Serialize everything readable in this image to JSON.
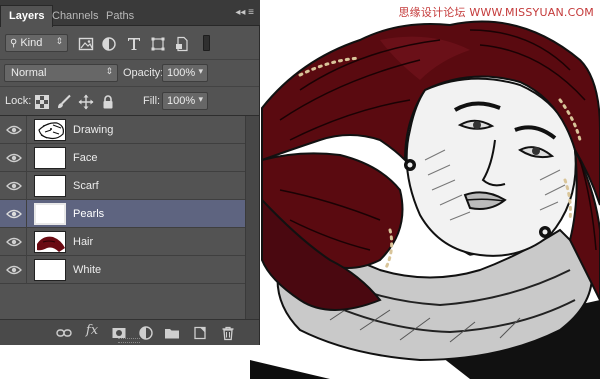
{
  "watermark": "思缘设计论坛 WWW.MISSYUAN.COM",
  "panel": {
    "tabs": [
      "Layers",
      "Channels",
      "Paths"
    ],
    "active_tab": "Layers",
    "menu_glyph": "◂◂ ≡",
    "filter": {
      "kind_label": "Kind",
      "filter_icons": [
        "image-filter-icon",
        "adjustment-filter-icon",
        "type-filter-icon",
        "shape-filter-icon",
        "smart-object-filter-icon"
      ]
    },
    "blend_mode": "Normal",
    "opacity_label": "Opacity:",
    "opacity_value": "100%",
    "lock_label": "Lock:",
    "lock_icons": [
      "lock-transparent-pixels-icon",
      "lock-image-pixels-icon",
      "lock-position-icon",
      "lock-all-icon"
    ],
    "fill_label": "Fill:",
    "fill_value": "100%",
    "layers": [
      {
        "name": "Drawing",
        "visible": true,
        "selected": false,
        "thumb": "drawing"
      },
      {
        "name": "Face",
        "visible": true,
        "selected": false,
        "thumb": "transparent"
      },
      {
        "name": "Scarf",
        "visible": true,
        "selected": false,
        "thumb": "transparent"
      },
      {
        "name": "Pearls",
        "visible": true,
        "selected": true,
        "thumb": "transparent"
      },
      {
        "name": "Hair",
        "visible": true,
        "selected": false,
        "thumb": "hair"
      },
      {
        "name": "White",
        "visible": true,
        "selected": false,
        "thumb": "white"
      }
    ],
    "bottom_icons": [
      "link-layers-icon",
      "fx-icon",
      "add-mask-icon",
      "adjustment-layer-icon",
      "new-group-icon",
      "new-layer-icon",
      "trash-icon"
    ],
    "fx_label": "fx"
  },
  "colors": {
    "panel_bg": "#535353",
    "selected_row": "#5e6480",
    "hair": "#5a0a10",
    "scarf": "#c9c9c9"
  }
}
